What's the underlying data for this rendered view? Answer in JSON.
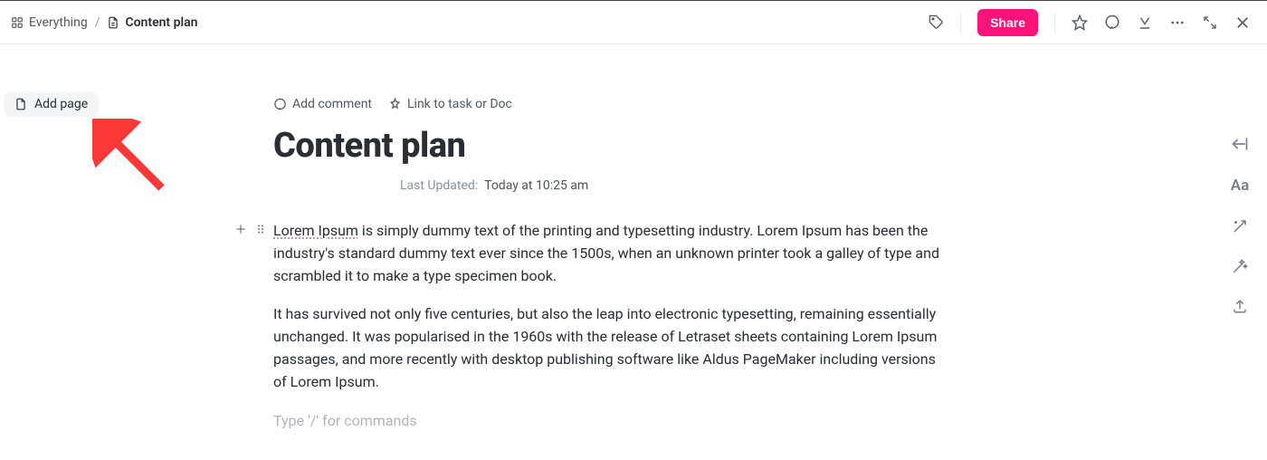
{
  "breadcrumb": {
    "root": "Everything",
    "current": "Content plan"
  },
  "topbar": {
    "share": "Share"
  },
  "sidebar": {
    "add_page": "Add page"
  },
  "doc": {
    "actions": {
      "add_comment": "Add comment",
      "link_task": "Link to task or Doc"
    },
    "title": "Content plan",
    "updated_label": "Last Updated:",
    "updated_when": "Today at 10:25 am",
    "para1_spell": "Lorem Ipsum",
    "para1_rest": " is simply dummy text of the printing and typesetting industry. Lorem Ipsum has been the industry's standard dummy text ever since the 1500s, when an unknown printer took a galley of type and scrambled it to make a type specimen book.",
    "para2": "It has survived not only five centuries, but also the leap into electronic typesetting, remaining essentially unchanged. It was popularised in the 1960s with the release of Letraset sheets containing Lorem Ipsum passages, and more recently with desktop publishing software like Aldus PageMaker including versions of Lorem Ipsum.",
    "placeholder": "Type '/' for commands"
  }
}
